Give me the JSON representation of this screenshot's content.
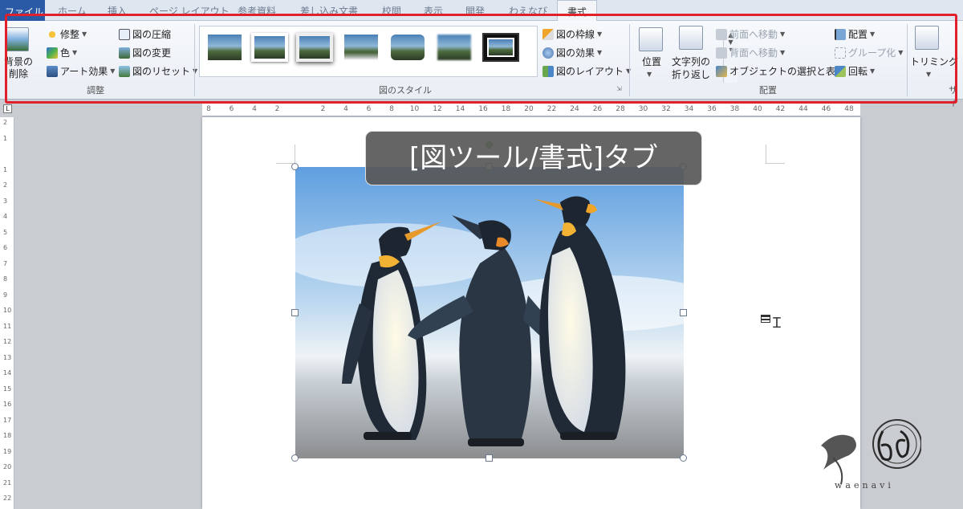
{
  "tabs": {
    "file": "ファイル",
    "home": "ホーム",
    "insert": "挿入",
    "page_layout": "ページ レイアウト",
    "references": "参考資料",
    "mailings": "差し込み文書",
    "review": "校閲",
    "view": "表示",
    "developer": "開発",
    "waenavi": "わえなび",
    "format": "書式"
  },
  "ribbon": {
    "adjust": {
      "remove_background": "背景の\n削除",
      "corrections": "修整",
      "color": "色",
      "artistic_effects": "アート効果",
      "compress": "図の圧縮",
      "change_picture": "図の変更",
      "reset_picture": "図のリセット",
      "group_label": "調整"
    },
    "picture_styles": {
      "border": "図の枠線",
      "effects": "図の効果",
      "layout": "図のレイアウト",
      "group_label": "図のスタイル"
    },
    "arrange": {
      "position": "位置",
      "wrap_text_1": "文字列の",
      "wrap_text_2": "折り返し",
      "bring_forward": "前面へ移動",
      "send_backward": "背面へ移動",
      "selection_pane": "オブジェクトの選択と表示",
      "align": "配置",
      "group": "グループ化",
      "rotate": "回転",
      "group_label": "配置"
    },
    "size": {
      "crop": "トリミング",
      "group_label_partial": "サイ"
    }
  },
  "ruler": {
    "ticks": [
      "8",
      "6",
      "4",
      "2",
      "",
      "2",
      "4",
      "6",
      "8",
      "10",
      "12",
      "14",
      "16",
      "18",
      "20",
      "22",
      "24",
      "26",
      "28",
      "30",
      "32",
      "34",
      "36",
      "38",
      "40",
      "42",
      "44",
      "46",
      "48"
    ],
    "vticks": [
      "2",
      "1",
      "",
      "1",
      "2",
      "3",
      "4",
      "5",
      "6",
      "7",
      "8",
      "9",
      "10",
      "11",
      "12",
      "13",
      "14",
      "15",
      "16",
      "17",
      "18",
      "19",
      "20",
      "21",
      "22"
    ],
    "corner_label": "L"
  },
  "document": {
    "caption": "[図ツール/書式]タブ"
  },
  "watermark": {
    "brand": "waenavi"
  },
  "colors": {
    "highlight": "#e0202a",
    "file_tab": "#2a5aa6"
  }
}
